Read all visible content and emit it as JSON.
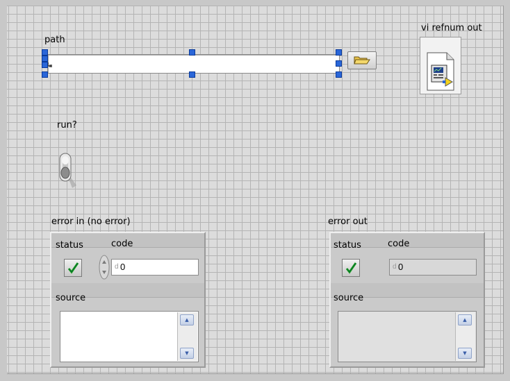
{
  "path": {
    "label": "path",
    "value": ""
  },
  "vi_refnum": {
    "label": "vi refnum out"
  },
  "run": {
    "label": "run?",
    "state": "off"
  },
  "error_in": {
    "title": "error in (no error)",
    "status_label": "status",
    "code_label": "code",
    "code_value": "0",
    "radix": "d",
    "source_label": "source",
    "source_value": ""
  },
  "error_out": {
    "title": "error out",
    "status_label": "status",
    "code_label": "code",
    "code_value": "0",
    "radix": "d",
    "source_label": "source",
    "source_value": ""
  },
  "icons": {
    "path_type": "path-symbol-icon",
    "browse": "folder-open-icon",
    "refnum": "vi-document-icon",
    "status_ok": "green-checkmark-icon",
    "scroll_up": "arrow-up-icon",
    "scroll_down": "arrow-down-icon"
  },
  "colors": {
    "selection_handle": "#2a66d8",
    "check_green": "#1ea01e",
    "panel_grid": "#b4b4b4",
    "panel_bg": "#dcdcdc"
  }
}
